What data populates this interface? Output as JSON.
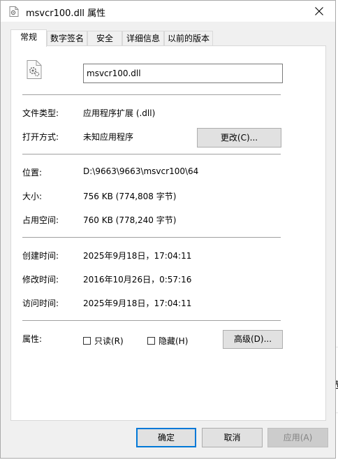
{
  "window": {
    "title": "msvcr100.dll 属性"
  },
  "tabs": [
    {
      "label": "常规",
      "active": true
    },
    {
      "label": "数字签名"
    },
    {
      "label": "安全"
    },
    {
      "label": "详细信息"
    },
    {
      "label": "以前的版本"
    }
  ],
  "general": {
    "filename": "msvcr100.dll",
    "file_type_label": "文件类型:",
    "file_type_value": "应用程序扩展 (.dll)",
    "opens_with_label": "打开方式:",
    "opens_with_value": "未知应用程序",
    "change_button": "更改(C)...",
    "location_label": "位置:",
    "location_value": "D:\\9663\\9663\\msvcr100\\64",
    "size_label": "大小:",
    "size_value": "756 KB (774,808 字节)",
    "size_on_disk_label": "占用空间:",
    "size_on_disk_value": "760 KB (778,240 字节)",
    "created_label": "创建时间:",
    "created_value": "2025年9月18日，17:04:11",
    "modified_label": "修改时间:",
    "modified_value": "2016年10月26日，0:57:16",
    "accessed_label": "访问时间:",
    "accessed_value": "2025年9月18日，17:04:11",
    "attributes_label": "属性:",
    "readonly_label": "只读(R)",
    "hidden_label": "隐藏(H)",
    "advanced_button": "高级(D)..."
  },
  "footer": {
    "ok": "确定",
    "cancel": "取消",
    "apply": "应用(A)"
  },
  "colors": {
    "accent": "#0078d7",
    "button_face": "#e1e1e1",
    "dialog_bg": "#f0f0f0"
  }
}
